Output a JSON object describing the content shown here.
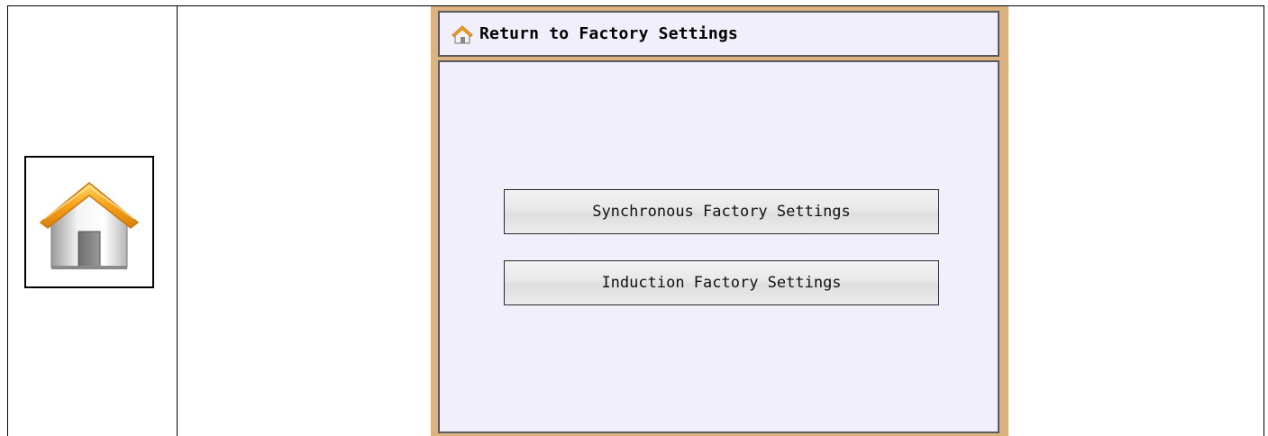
{
  "panel": {
    "title": "Return to Factory Settings",
    "title_icon": "home-icon"
  },
  "buttons": {
    "synchronous": "Synchronous Factory Settings",
    "induction": "Induction Factory Settings"
  },
  "side_icon": "home-icon",
  "colors": {
    "panel_frame": "#dcb380",
    "panel_background": "#f0effb",
    "roof": "#f5a623",
    "button_border": "#2a2a2a"
  }
}
